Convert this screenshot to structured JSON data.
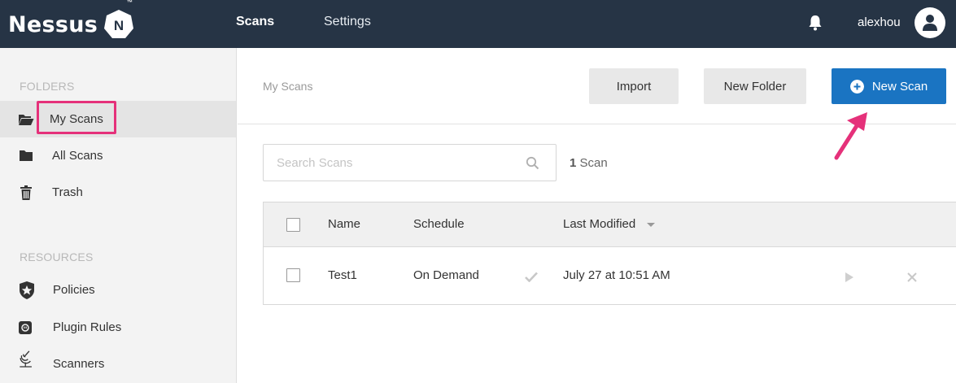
{
  "topbar": {
    "brand": "Nessus",
    "brand_mark": "N",
    "trademark": "™",
    "nav": {
      "scans": "Scans",
      "settings": "Settings"
    },
    "username": "alexhou",
    "colors": {
      "background": "#263445"
    }
  },
  "sidebar": {
    "folders_heading": "FOLDERS",
    "folders": [
      {
        "label": "My Scans",
        "icon": "folder-open-icon",
        "active": true
      },
      {
        "label": "All Scans",
        "icon": "folder-icon"
      },
      {
        "label": "Trash",
        "icon": "trash-icon"
      }
    ],
    "resources_heading": "RESOURCES",
    "resources": [
      {
        "label": "Policies",
        "icon": "shield-star-icon"
      },
      {
        "label": "Plugin Rules",
        "icon": "plugin-icon"
      },
      {
        "label": "Scanners",
        "icon": "radar-icon"
      }
    ]
  },
  "main": {
    "breadcrumb": "My Scans",
    "buttons": {
      "import": "Import",
      "new_folder": "New Folder",
      "new_scan": "New Scan"
    },
    "search": {
      "placeholder": "Search Scans",
      "value": ""
    },
    "scan_count": {
      "number": "1",
      "label": "Scan"
    },
    "table": {
      "columns": {
        "name": "Name",
        "schedule": "Schedule",
        "last_modified": "Last Modified"
      },
      "rows": [
        {
          "name": "Test1",
          "schedule": "On Demand",
          "last_modified": "July 27 at 10:51 AM"
        }
      ]
    },
    "colors": {
      "primary": "#1a74c2",
      "annotation": "#e5317a"
    }
  }
}
